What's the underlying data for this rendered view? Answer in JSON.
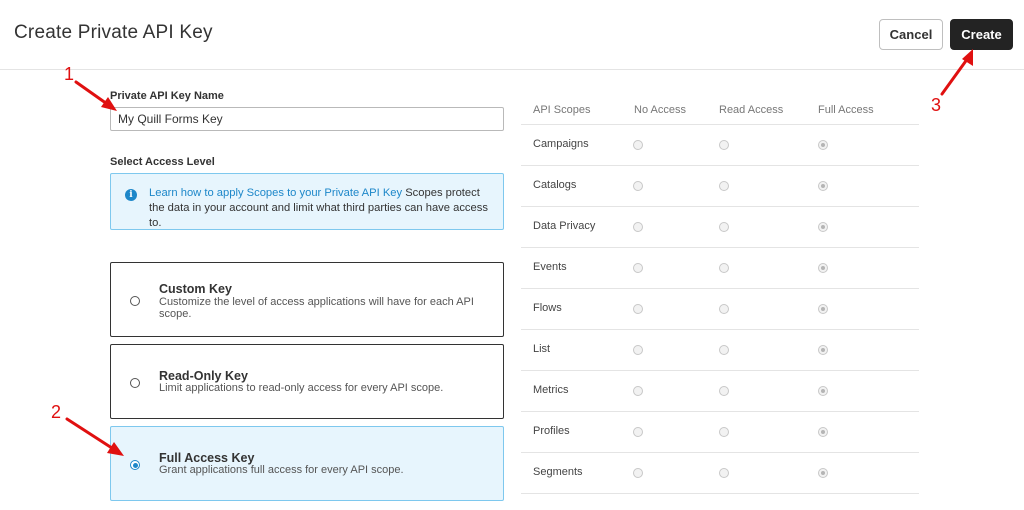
{
  "header": {
    "title": "Create Private API Key",
    "cancel_label": "Cancel",
    "create_label": "Create"
  },
  "form": {
    "name_label": "Private API Key Name",
    "name_value": "My Quill Forms Key",
    "access_label": "Select Access Level",
    "info": {
      "icon": "info-icon",
      "link_text": "Learn how to apply Scopes to your Private API Key",
      "text": " Scopes protect the data in your account and limit what third parties can have access to."
    },
    "options": [
      {
        "title": "Custom Key",
        "description": "Customize the level of access applications will have for each API scope.",
        "selected": false
      },
      {
        "title": "Read-Only Key",
        "description": "Limit applications to read-only access for every API scope.",
        "selected": false
      },
      {
        "title": "Full Access Key",
        "description": "Grant applications full access for every API scope.",
        "selected": true
      }
    ]
  },
  "scopes": {
    "headers": [
      "API Scopes",
      "No Access",
      "Read Access",
      "Full Access"
    ],
    "rows": [
      {
        "name": "Campaigns",
        "access": "Full Access"
      },
      {
        "name": "Catalogs",
        "access": "Full Access"
      },
      {
        "name": "Data Privacy",
        "access": "Full Access"
      },
      {
        "name": "Events",
        "access": "Full Access"
      },
      {
        "name": "Flows",
        "access": "Full Access"
      },
      {
        "name": "List",
        "access": "Full Access"
      },
      {
        "name": "Metrics",
        "access": "Full Access"
      },
      {
        "name": "Profiles",
        "access": "Full Access"
      },
      {
        "name": "Segments",
        "access": "Full Access"
      }
    ]
  },
  "annotations": {
    "one": "1",
    "two": "2",
    "three": "3",
    "color": "#e01010"
  },
  "colors": {
    "accent": "#1d87c9",
    "primary_button": "#232323",
    "selected_card_bg": "#e7f5fd"
  }
}
